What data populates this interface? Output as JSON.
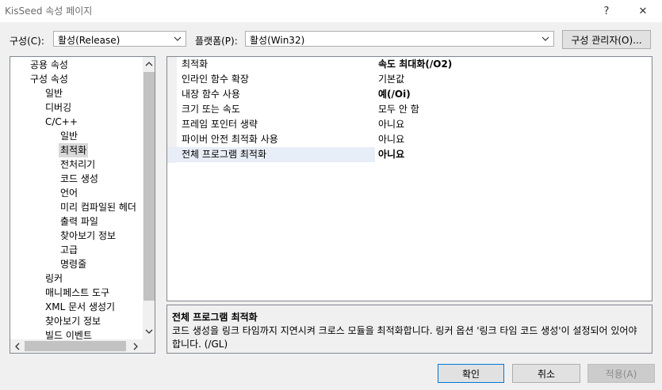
{
  "window": {
    "title": "KisSeed 속성 페이지",
    "help_icon": "?",
    "close_icon": "✕"
  },
  "config": {
    "label": "구성(C):",
    "value": "활성(Release)"
  },
  "platform": {
    "label": "플랫폼(P):",
    "value": "활성(Win32)"
  },
  "config_manager_label": "구성 관리자(O)...",
  "tree": {
    "items": [
      {
        "label": "공용 속성"
      },
      {
        "label": "구성 속성"
      },
      {
        "label": "일반"
      },
      {
        "label": "디버깅"
      },
      {
        "label": "C/C++"
      },
      {
        "label": "일반"
      },
      {
        "label": "최적화"
      },
      {
        "label": "전처리기"
      },
      {
        "label": "코드 생성"
      },
      {
        "label": "언어"
      },
      {
        "label": "미리 컴파일된 헤더"
      },
      {
        "label": "출력 파일"
      },
      {
        "label": "찾아보기 정보"
      },
      {
        "label": "고급"
      },
      {
        "label": "명령줄"
      },
      {
        "label": "링커"
      },
      {
        "label": "매니페스트 도구"
      },
      {
        "label": "XML 문서 생성기"
      },
      {
        "label": "찾아보기 정보"
      },
      {
        "label": "빌드 이벤트"
      }
    ]
  },
  "properties": [
    {
      "name": "최적화",
      "value": "속도 최대화(/O2)"
    },
    {
      "name": "인라인 함수 확장",
      "value": "기본값"
    },
    {
      "name": "내장 함수 사용",
      "value": "예(/Oi)"
    },
    {
      "name": "크기 또는 속도",
      "value": "모두 안 함"
    },
    {
      "name": "프레임 포인터 생략",
      "value": "아니요"
    },
    {
      "name": "파이버 안전 최적화 사용",
      "value": "아니요"
    },
    {
      "name": "전체 프로그램 최적화",
      "value": "아니요"
    }
  ],
  "description": {
    "title": "전체 프로그램 최적화",
    "text": "코드 생성을 링크 타임까지 지연시켜 크로스 모듈을 최적화합니다. 링커 옵션 '링크 타임 코드 생성'이 설정되어 있어야 합니다.    (/GL)"
  },
  "buttons": {
    "ok": "확인",
    "cancel": "취소",
    "apply": "적용(A)"
  }
}
